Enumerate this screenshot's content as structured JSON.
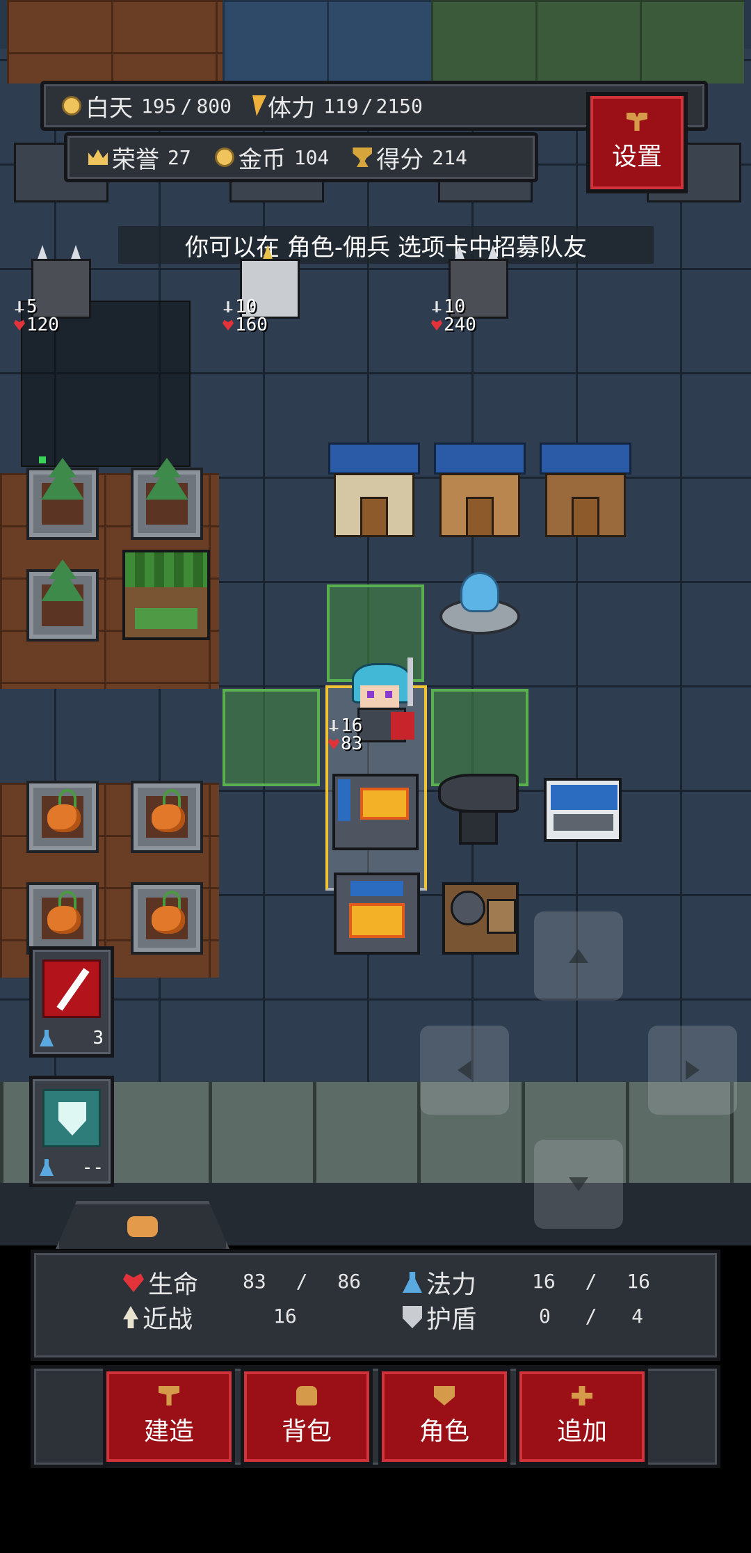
{
  "hud": {
    "day_label": "白天",
    "day_value": "195",
    "day_max": "800",
    "stamina_label": "体力",
    "stamina_value": "119",
    "stamina_max": "2150",
    "honor_label": "荣誉",
    "honor_value": "27",
    "gold_label": "金币",
    "gold_value": "104",
    "score_label": "得分",
    "score_value": "214",
    "settings_label": "设置"
  },
  "hint": "你可以在 角色-佣兵 选项卡中招募队友",
  "mercenaries": [
    {
      "atk": "5",
      "hp": "120"
    },
    {
      "atk": "10",
      "hp": "160"
    },
    {
      "atk": "10",
      "hp": "240"
    }
  ],
  "hero": {
    "atk": "16",
    "hp": "83"
  },
  "skills": [
    {
      "name": "sword-skill",
      "cost": "3"
    },
    {
      "name": "shield-skill",
      "cost": "--"
    }
  ],
  "stats": {
    "hp_label": "生命",
    "hp_value": "83",
    "hp_max": "86",
    "mp_label": "法力",
    "mp_value": "16",
    "mp_max": "16",
    "melee_label": "近战",
    "melee_value": "16",
    "shield_label": "护盾",
    "shield_value": "0",
    "shield_max": "4",
    "sep": "/"
  },
  "actions": {
    "build": "建造",
    "bag": "背包",
    "character": "角色",
    "add": "追加"
  },
  "colors": {
    "accent_red": "#9b0f16",
    "panel": "#2d3138",
    "highlight_green": "#5ab04f"
  }
}
